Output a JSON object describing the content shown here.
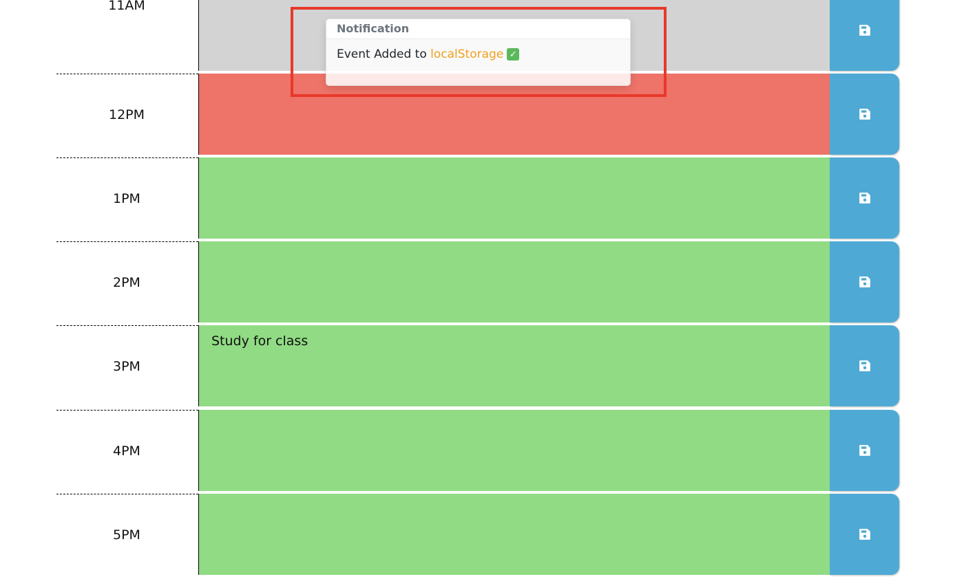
{
  "toast": {
    "title": "Notification",
    "message_prefix": "Event Added to ",
    "message_highlight": "localStorage",
    "check_glyph": "✓"
  },
  "rows": [
    {
      "hour": "11AM",
      "text": "",
      "status": "past"
    },
    {
      "hour": "12PM",
      "text": "",
      "status": "present"
    },
    {
      "hour": "1PM",
      "text": "",
      "status": "future"
    },
    {
      "hour": "2PM",
      "text": "",
      "status": "future"
    },
    {
      "hour": "3PM",
      "text": "Study for class",
      "status": "future"
    },
    {
      "hour": "4PM",
      "text": "",
      "status": "future"
    },
    {
      "hour": "5PM",
      "text": "",
      "status": "future"
    }
  ],
  "colors": {
    "past": "#d3d3d3",
    "present": "#ee7368",
    "future": "#90db84",
    "save_button": "#4eaad4",
    "highlight": "#f0a020",
    "annotation": "#e8382b"
  },
  "icons": {
    "save": "save-icon",
    "check": "check-icon"
  }
}
